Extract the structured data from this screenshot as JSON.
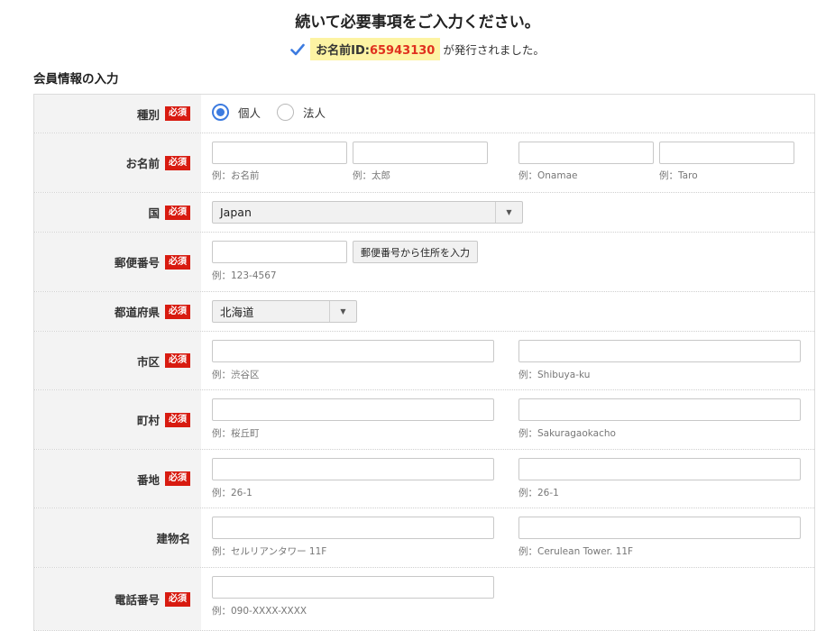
{
  "header": {
    "title": "続いて必要事項をご入力ください。",
    "id_label": "お名前ID:",
    "id_value": "65943130",
    "issued_text": "が発行されました。"
  },
  "section": {
    "title": "会員情報の入力"
  },
  "required_badge": "必須",
  "colors": {
    "required": "#d81b10",
    "accent": "#3c7be0",
    "id_highlight": "#fdf3a3",
    "id_number": "#e0301e"
  },
  "rows": {
    "type": {
      "label": "種別",
      "options": [
        "個人",
        "法人"
      ],
      "selected": "個人"
    },
    "name": {
      "label": "お名前",
      "inputs": [
        {
          "value": "",
          "hint": "例：お名前"
        },
        {
          "value": "",
          "hint": "例：太郎"
        },
        {
          "value": "",
          "hint": "例：Onamae"
        },
        {
          "value": "",
          "hint": "例：Taro"
        }
      ]
    },
    "country": {
      "label": "国",
      "selected": "Japan"
    },
    "postal": {
      "label": "郵便番号",
      "input": {
        "value": "",
        "hint": "例：123-4567"
      },
      "button": "郵便番号から住所を入力"
    },
    "prefecture": {
      "label": "都道府県",
      "selected": "北海道"
    },
    "city": {
      "label": "市区",
      "inputs": [
        {
          "value": "",
          "hint": "例：渋谷区"
        },
        {
          "value": "",
          "hint": "例：Shibuya-ku"
        }
      ]
    },
    "town": {
      "label": "町村",
      "inputs": [
        {
          "value": "",
          "hint": "例：桜丘町"
        },
        {
          "value": "",
          "hint": "例：Sakuragaokacho"
        }
      ]
    },
    "address": {
      "label": "番地",
      "inputs": [
        {
          "value": "",
          "hint": "例：26-1"
        },
        {
          "value": "",
          "hint": "例：26-1"
        }
      ]
    },
    "building": {
      "label": "建物名",
      "inputs": [
        {
          "value": "",
          "hint": "例：セルリアンタワー 11F"
        },
        {
          "value": "",
          "hint": "例：Cerulean Tower. 11F"
        }
      ]
    },
    "phone": {
      "label": "電話番号",
      "input": {
        "value": "",
        "hint": "例：090-XXXX-XXXX"
      }
    }
  }
}
